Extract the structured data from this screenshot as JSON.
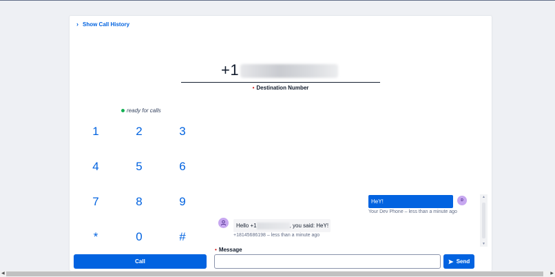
{
  "header": {
    "history_label": "Show Call History"
  },
  "dialer": {
    "destination_prefix": "+1",
    "destination_label": "Destination Number",
    "status_text": "ready for calls",
    "keys": [
      "1",
      "2",
      "3",
      "4",
      "5",
      "6",
      "7",
      "8",
      "9",
      "*",
      "0",
      "#"
    ],
    "call_label": "Call"
  },
  "chat": {
    "messages": [
      {
        "direction": "outgoing",
        "text": "HeY!",
        "avatar": "D",
        "meta": "Your Dev Phone – less than a minute ago"
      },
      {
        "direction": "incoming",
        "text_prefix": "Hello +1",
        "text_suffix": ", you said: HeY!",
        "meta": "+18145686198 – less than a minute ago"
      }
    ],
    "message_label": "Message",
    "message_value": "",
    "send_label": "Send"
  },
  "colors": {
    "accent": "#0263e0",
    "status_ok": "#14b053",
    "avatar": "#c7a7f0"
  }
}
